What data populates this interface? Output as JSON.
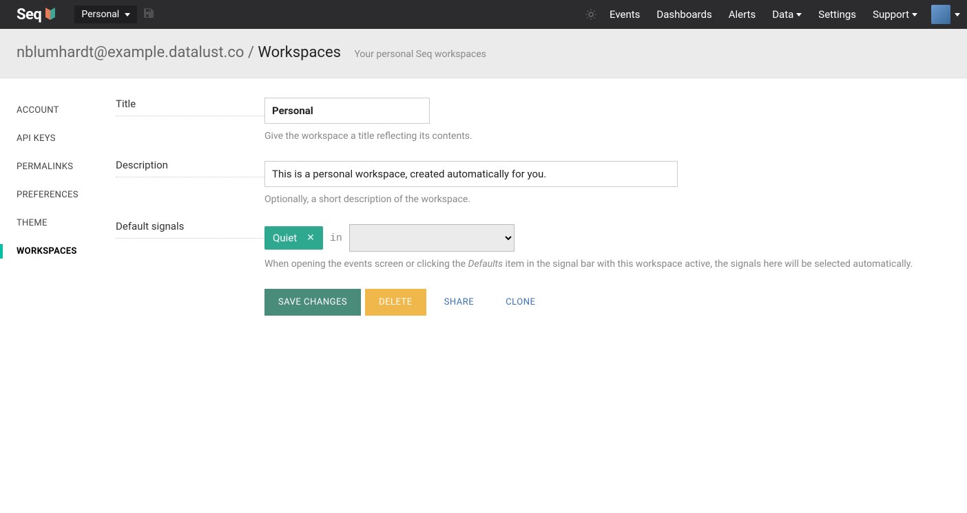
{
  "brand": "Seq",
  "workspaceSelector": "Personal",
  "nav": {
    "events": "Events",
    "dashboards": "Dashboards",
    "alerts": "Alerts",
    "data": "Data",
    "settings": "Settings",
    "support": "Support"
  },
  "header": {
    "user": "nblumhardt@example.datalust.co",
    "sep": " / ",
    "page": "Workspaces",
    "subtitle": "Your personal Seq workspaces"
  },
  "sidebar": [
    {
      "label": "ACCOUNT",
      "active": false
    },
    {
      "label": "API KEYS",
      "active": false
    },
    {
      "label": "PERMALINKS",
      "active": false
    },
    {
      "label": "PREFERENCES",
      "active": false
    },
    {
      "label": "THEME",
      "active": false
    },
    {
      "label": "WORKSPACES",
      "active": true
    }
  ],
  "form": {
    "titleLabel": "Title",
    "titleValue": "Personal",
    "titleHelp": "Give the workspace a title reflecting its contents.",
    "descLabel": "Description",
    "descValue": "This is a personal workspace, created automatically for you.",
    "descHelp": "Optionally, a short description of the workspace.",
    "signalsLabel": "Default signals",
    "signalChip": "Quiet",
    "inLabel": "in",
    "signalsHelpPre": "When opening the events screen or clicking the ",
    "signalsHelpEm": "Defaults",
    "signalsHelpPost": " item in the signal bar with this workspace active, the signals here will be selected automatically."
  },
  "buttons": {
    "save": "SAVE CHANGES",
    "delete": "DELETE",
    "share": "SHARE",
    "clone": "CLONE"
  }
}
